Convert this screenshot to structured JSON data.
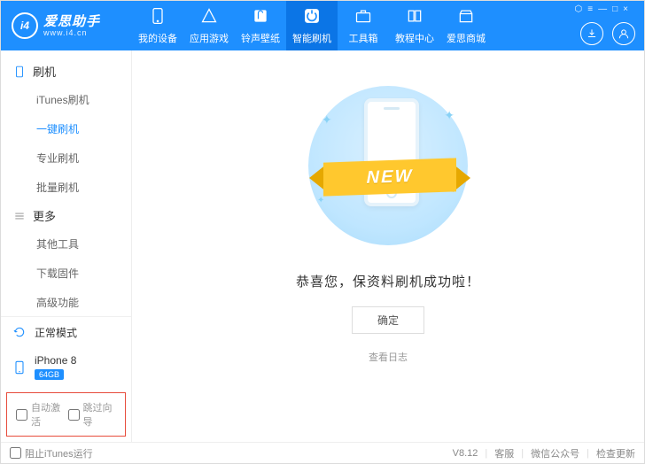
{
  "logo": {
    "badge": "i4",
    "title": "爱思助手",
    "url": "www.i4.cn"
  },
  "winctrls": {
    "lock": "⬡",
    "menu": "≡",
    "min": "—",
    "max": "□",
    "close": "×"
  },
  "topnav": [
    {
      "label": "我的设备"
    },
    {
      "label": "应用游戏"
    },
    {
      "label": "铃声壁纸"
    },
    {
      "label": "智能刷机"
    },
    {
      "label": "工具箱"
    },
    {
      "label": "教程中心"
    },
    {
      "label": "爱思商城"
    }
  ],
  "sidebar": {
    "group1_title": "刷机",
    "group1": [
      {
        "label": "iTunes刷机"
      },
      {
        "label": "一键刷机"
      },
      {
        "label": "专业刷机"
      },
      {
        "label": "批量刷机"
      }
    ],
    "group2_title": "更多",
    "group2": [
      {
        "label": "其他工具"
      },
      {
        "label": "下载固件"
      },
      {
        "label": "高级功能"
      }
    ]
  },
  "mode": "正常模式",
  "device": {
    "name": "iPhone 8",
    "storage": "64GB"
  },
  "checks": {
    "auto_activate": "自动激活",
    "skip_guide": "跳过向导"
  },
  "main": {
    "ribbon": "NEW",
    "message": "恭喜您，保资料刷机成功啦！",
    "ok": "确定",
    "log": "查看日志"
  },
  "footer": {
    "block_itunes": "阻止iTunes运行",
    "version": "V8.12",
    "support": "客服",
    "wechat": "微信公众号",
    "update": "检查更新"
  }
}
